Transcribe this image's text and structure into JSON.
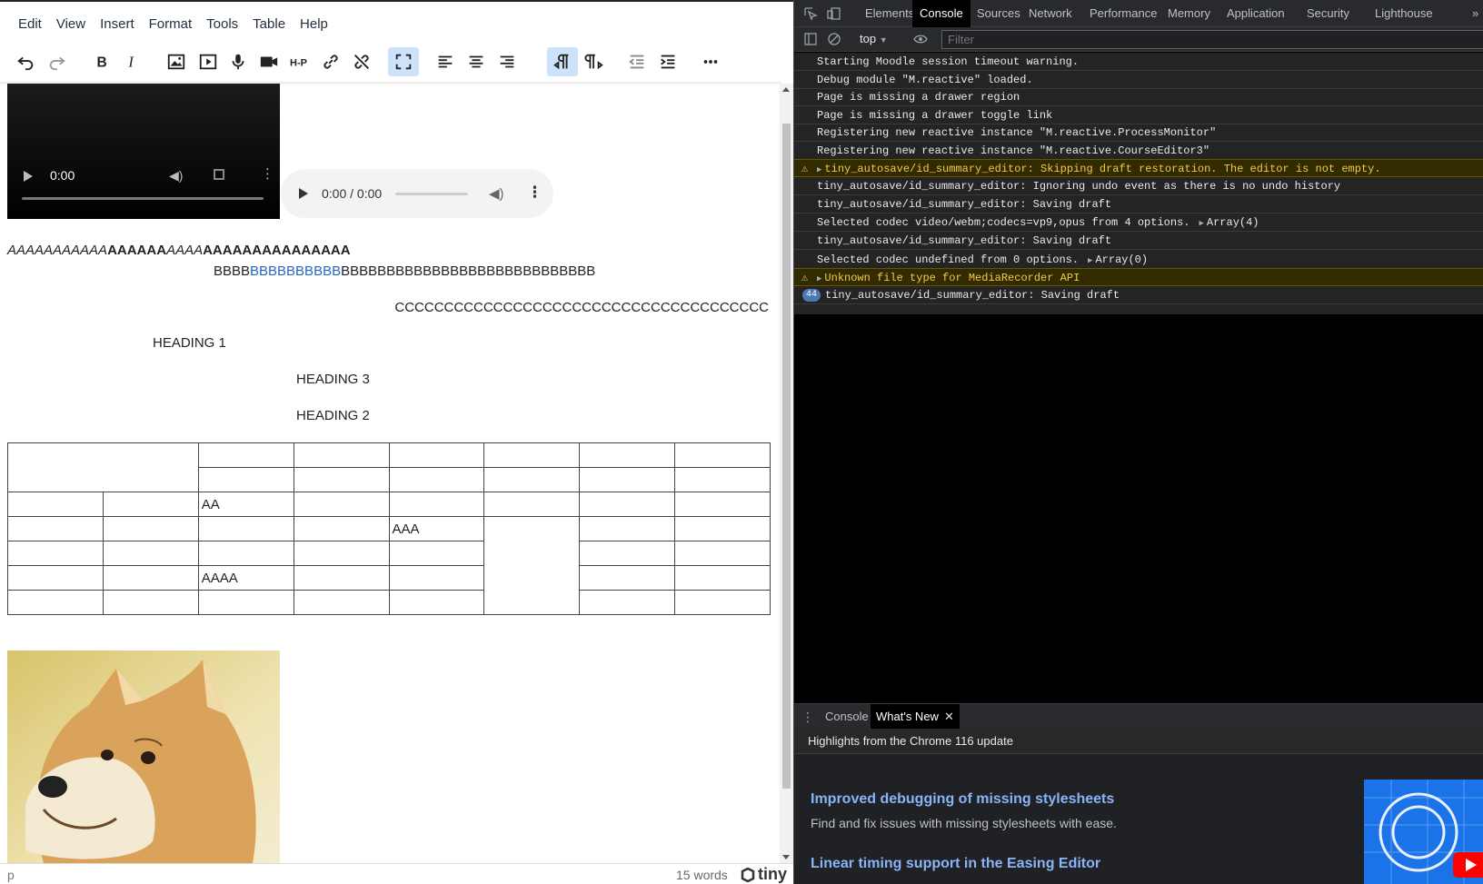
{
  "editor": {
    "menu": [
      "Edit",
      "View",
      "Insert",
      "Format",
      "Tools",
      "Table",
      "Help"
    ],
    "toolbar": [
      {
        "name": "undo-icon"
      },
      {
        "name": "redo-icon"
      },
      {
        "name": "bold-icon"
      },
      {
        "name": "italic-icon"
      },
      {
        "name": "image-icon"
      },
      {
        "name": "media-icon"
      },
      {
        "name": "microphone-icon"
      },
      {
        "name": "video-camera-icon"
      },
      {
        "name": "h5p-icon"
      },
      {
        "name": "link-icon"
      },
      {
        "name": "unlink-icon"
      },
      {
        "name": "fullscreen-icon"
      },
      {
        "name": "align-left-icon"
      },
      {
        "name": "align-center-icon"
      },
      {
        "name": "align-right-icon"
      },
      {
        "name": "ltr-icon"
      },
      {
        "name": "rtl-icon"
      },
      {
        "name": "outdent-icon"
      },
      {
        "name": "indent-icon"
      },
      {
        "name": "more-icon"
      }
    ],
    "video_time": "0:00",
    "audio_time": "0:00 / 0:00",
    "line_a": {
      "italic1": "AAAAAAAAAAA",
      "bold1": "AAAAAA",
      "italic2": "AAAA",
      "bold2": "AAAAAAAAAAAAAAA"
    },
    "line_b": {
      "p1": "BBBB",
      "blue": "BBBBBBBBBB",
      "p2": "BBBBBBBBBBBBBBBBBBBBBBBBBBBB"
    },
    "line_c": "CCCCCCCCCCCCCCCCCCCCCCCCCCCCCCCCCCCCCC",
    "heading1": "HEADING 1",
    "heading3": "HEADING 3",
    "heading2": "HEADING 2",
    "table_cells": {
      "aa": "AA",
      "aaa": "AAA",
      "aaaa": "AAAA"
    },
    "status_path": "p",
    "word_count": "15 words",
    "brand": "tiny"
  },
  "devtools": {
    "tabs": [
      "Elements",
      "Console",
      "Sources",
      "Network",
      "Performance",
      "Memory",
      "Application",
      "Security",
      "Lighthouse"
    ],
    "active_tab": "Console",
    "more_tabs": "»",
    "context": "top",
    "filter_placeholder": "Filter",
    "logs": [
      {
        "text": "Starting Moodle session timeout warning.",
        "level": "info"
      },
      {
        "text": "Debug module \"M.reactive\" loaded.",
        "level": "info"
      },
      {
        "text": "Page is missing a drawer region",
        "level": "info"
      },
      {
        "text": "Page is missing a drawer toggle link",
        "level": "info"
      },
      {
        "text": "Registering new reactive instance \"M.reactive.ProcessMonitor\"",
        "level": "info"
      },
      {
        "text": "Registering new reactive instance \"M.reactive.CourseEditor3\"",
        "level": "info"
      },
      {
        "text": "tiny_autosave/id_summary_editor: Skipping draft restoration. The editor is not empty.",
        "level": "warn"
      },
      {
        "text": "tiny_autosave/id_summary_editor: Ignoring undo event as there is no undo history",
        "level": "info"
      },
      {
        "text": "tiny_autosave/id_summary_editor: Saving draft",
        "level": "info"
      },
      {
        "text": "Selected codec video/webm;codecs=vp9,opus from 4 options.",
        "level": "info",
        "extra": "Array(4)"
      },
      {
        "text": "tiny_autosave/id_summary_editor: Saving draft",
        "level": "info"
      },
      {
        "text": "Selected codec undefined from 0 options.",
        "level": "info",
        "extra": "Array(0)"
      },
      {
        "text": "Unknown file type for MediaRecorder API",
        "level": "warn"
      },
      {
        "text": "tiny_autosave/id_summary_editor: Saving draft",
        "level": "info",
        "count": "44"
      }
    ],
    "drawer_tabs": [
      "Console",
      "What's New"
    ],
    "drawer_active": "What's New",
    "whatsnew": {
      "header": "Highlights from the Chrome 116 update",
      "item1_title": "Improved debugging of missing stylesheets",
      "item1_desc": "Find and fix issues with missing stylesheets with ease.",
      "item2_title": "Linear timing support in the Easing Editor"
    },
    "colors": {
      "accent": "#8ab4f8",
      "warn": "#f2c94c",
      "panel": "#292a2d"
    }
  }
}
